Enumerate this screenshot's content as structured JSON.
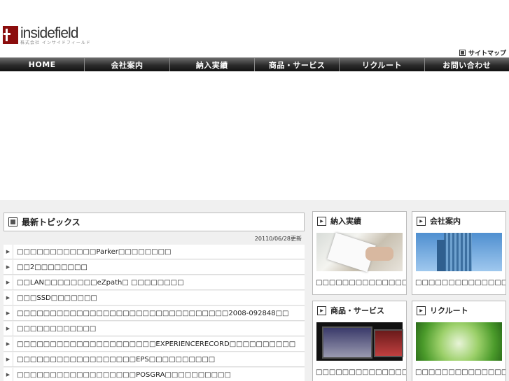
{
  "header": {
    "logo_name": "insidefield",
    "logo_sub": "株式会社 インサイドフィールド",
    "sitemap_label": "サイトマップ"
  },
  "nav": {
    "items": [
      "HOME",
      "会社案内",
      "納入実績",
      "商品・サービス",
      "リクルート",
      "お問い合わせ"
    ]
  },
  "topics": {
    "title": "最新トピックス",
    "date": "20110/06/28更新",
    "items": [
      "□□□□□□□□□□□□Parker□□□□□□□□",
      "□□2□□□□□□□□",
      "□□LAN□□□□□□□□eZpath□ □□□□□□□□",
      "□□□SSD□□□□□□□",
      "□□□□□□□□□□□□□□□□□□□□□□□□□□□□□□□□2008-092848□□",
      "□□□□□□□□□□□□",
      "□□□□□□□□□□□□□□□□□□□□□EXPERIENCERECORD□□□□□□□□□□",
      "□□□□□□□□□□□□□□□□□□EPS□□□□□□□□□□",
      "□□□□□□□□□□□□□□□□□□POSGRA□□□□□□□□□□"
    ]
  },
  "cards": {
    "delivery": {
      "title": "納入実績",
      "text": "□□□□□□□□□□□□□□□□□□□□□□□□"
    },
    "company": {
      "title": "会社案内",
      "text": "□□□□□□□□□□□□□□□□□□"
    },
    "products": {
      "title": "商品・サービス",
      "text": "□□□□□□□□□□□□□□□□□□□□□□□□"
    },
    "recruit": {
      "title": "リクルート",
      "text": "□□□□□□□□□□□□□□□□□□□□□□□□"
    }
  },
  "colors": {
    "logo_red": "#8b0d0d",
    "topic_highlight": "#1a9b9b",
    "nav_dark": "#1a1a1a"
  }
}
